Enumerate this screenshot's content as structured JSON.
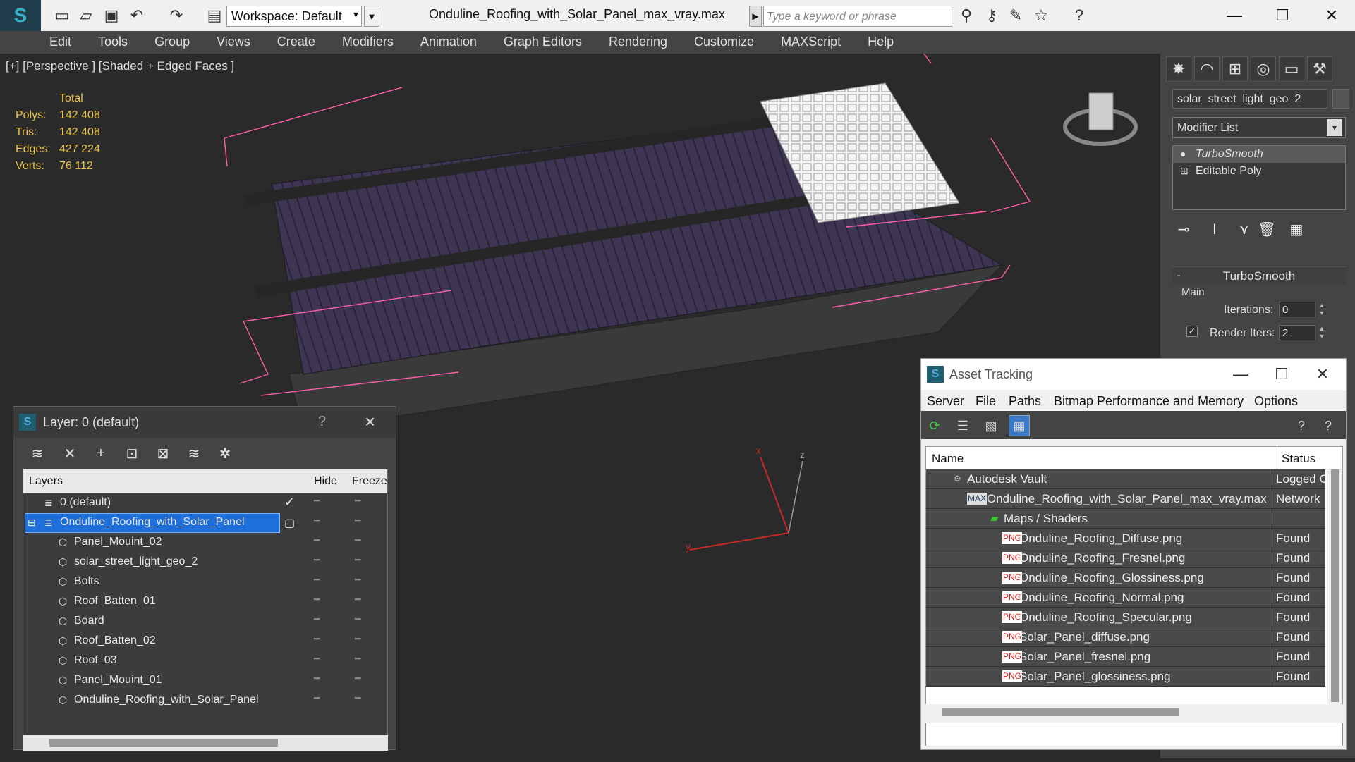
{
  "titlebar": {
    "workspace": "Workspace: Default",
    "file_title": "Onduline_Roofing_with_Solar_Panel_max_vray.max",
    "search_placeholder": "Type a keyword or phrase"
  },
  "menu": [
    "Edit",
    "Tools",
    "Group",
    "Views",
    "Create",
    "Modifiers",
    "Animation",
    "Graph Editors",
    "Rendering",
    "Customize",
    "MAXScript",
    "Help"
  ],
  "viewport": {
    "label": "[+] [Perspective ] [Shaded + Edged Faces ]",
    "stats_header": "Total",
    "stats": [
      {
        "k": "Polys:",
        "v": "142 408"
      },
      {
        "k": "Tris:",
        "v": "142 408"
      },
      {
        "k": "Edges:",
        "v": "427 224"
      },
      {
        "k": "Verts:",
        "v": "76 112"
      }
    ],
    "axis_x": "x",
    "axis_y": "y",
    "axis_z": "z"
  },
  "command_panel": {
    "object_name": "solar_street_light_geo_2",
    "modifier_list": "Modifier List",
    "stack": [
      "TurboSmooth",
      "Editable Poly"
    ],
    "rollout_title": "TurboSmooth",
    "rollout_minus": "-",
    "group_main": "Main",
    "iterations_label": "Iterations:",
    "iterations_value": "0",
    "render_iters_label": "Render Iters:",
    "render_iters_value": "2"
  },
  "layer_window": {
    "title": "Layer: 0 (default)",
    "help": "?",
    "col_layers": "Layers",
    "col_hide": "Hide",
    "col_freeze": "Freeze",
    "rows": [
      {
        "name": "0 (default)"
      },
      {
        "name": "Onduline_Roofing_with_Solar_Panel"
      },
      {
        "name": "Panel_Mouint_02"
      },
      {
        "name": "solar_street_light_geo_2"
      },
      {
        "name": "Bolts"
      },
      {
        "name": "Roof_Batten_01"
      },
      {
        "name": "Board"
      },
      {
        "name": "Roof_Batten_02"
      },
      {
        "name": "Roof_03"
      },
      {
        "name": "Panel_Mouint_01"
      },
      {
        "name": "Onduline_Roofing_with_Solar_Panel"
      }
    ]
  },
  "asset_window": {
    "title": "Asset Tracking",
    "menu": [
      "Server",
      "File",
      "Paths",
      "Bitmap Performance and Memory",
      "Options"
    ],
    "col_name": "Name",
    "col_status": "Status",
    "rows": [
      {
        "name": "Autodesk Vault",
        "status": "Logged Out"
      },
      {
        "name": "Onduline_Roofing_with_Solar_Panel_max_vray.max",
        "status": "Network"
      },
      {
        "name": "Maps / Shaders",
        "status": ""
      },
      {
        "name": "Onduline_Roofing_Diffuse.png",
        "status": "Found"
      },
      {
        "name": "Onduline_Roofing_Fresnel.png",
        "status": "Found"
      },
      {
        "name": "Onduline_Roofing_Glossiness.png",
        "status": "Found"
      },
      {
        "name": "Onduline_Roofing_Normal.png",
        "status": "Found"
      },
      {
        "name": "Onduline_Roofing_Specular.png",
        "status": "Found"
      },
      {
        "name": "Solar_Panel_diffuse.png",
        "status": "Found"
      },
      {
        "name": "Solar_Panel_fresnel.png",
        "status": "Found"
      },
      {
        "name": "Solar_Panel_glossiness.png",
        "status": "Found"
      }
    ],
    "png_badge": "PNG",
    "max_badge": "MAX"
  },
  "colors": {
    "accent": "#1e6fd9",
    "stats": "#e8c24a",
    "bbox": "#ff5fa8",
    "roof": "#3e3552"
  }
}
